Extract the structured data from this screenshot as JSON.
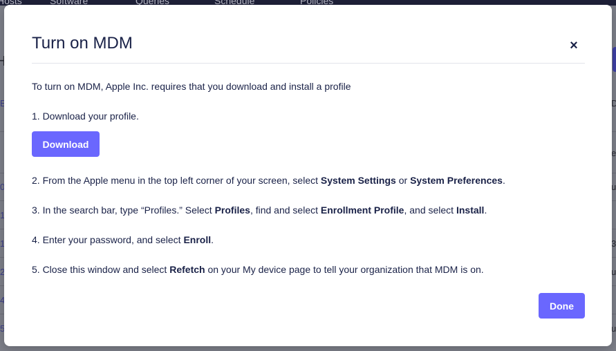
{
  "background": {
    "nav_items": [
      "Hosts",
      "Software",
      "Queries",
      "Schedule",
      "Policies"
    ],
    "left_links": [
      "E",
      "0",
      "1",
      "1",
      "2",
      "4",
      "5"
    ],
    "right_texts": [
      "D",
      "e",
      "u",
      "3",
      "u",
      "u"
    ],
    "left_header_glyph": "H"
  },
  "modal": {
    "title": "Turn on MDM",
    "close_label": "×",
    "intro": "To turn on MDM, Apple Inc. requires that you download and install a profile",
    "step1": "1. Download your profile.",
    "download_label": "Download",
    "step2": {
      "a": "2. From the Apple menu in the top left corner of your screen, select ",
      "b": "System Settings",
      "c": " or ",
      "d": "System Preferences",
      "e": "."
    },
    "step3": {
      "a": "3. In the search bar, type “Profiles.” Select ",
      "b": "Profiles",
      "c": ", find and select ",
      "d": "Enrollment Profile",
      "e": ", and select ",
      "f": "Install",
      "g": "."
    },
    "step4": {
      "a": "4. Enter your password, and select ",
      "b": "Enroll",
      "c": "."
    },
    "step5": {
      "a": "5. Close this window and select ",
      "b": "Refetch",
      "c": " on your My device page to tell your organization that MDM is on."
    },
    "done_label": "Done"
  },
  "colors": {
    "accent": "#6a67fe",
    "text": "#192147",
    "overlay": "#7d7f89"
  }
}
